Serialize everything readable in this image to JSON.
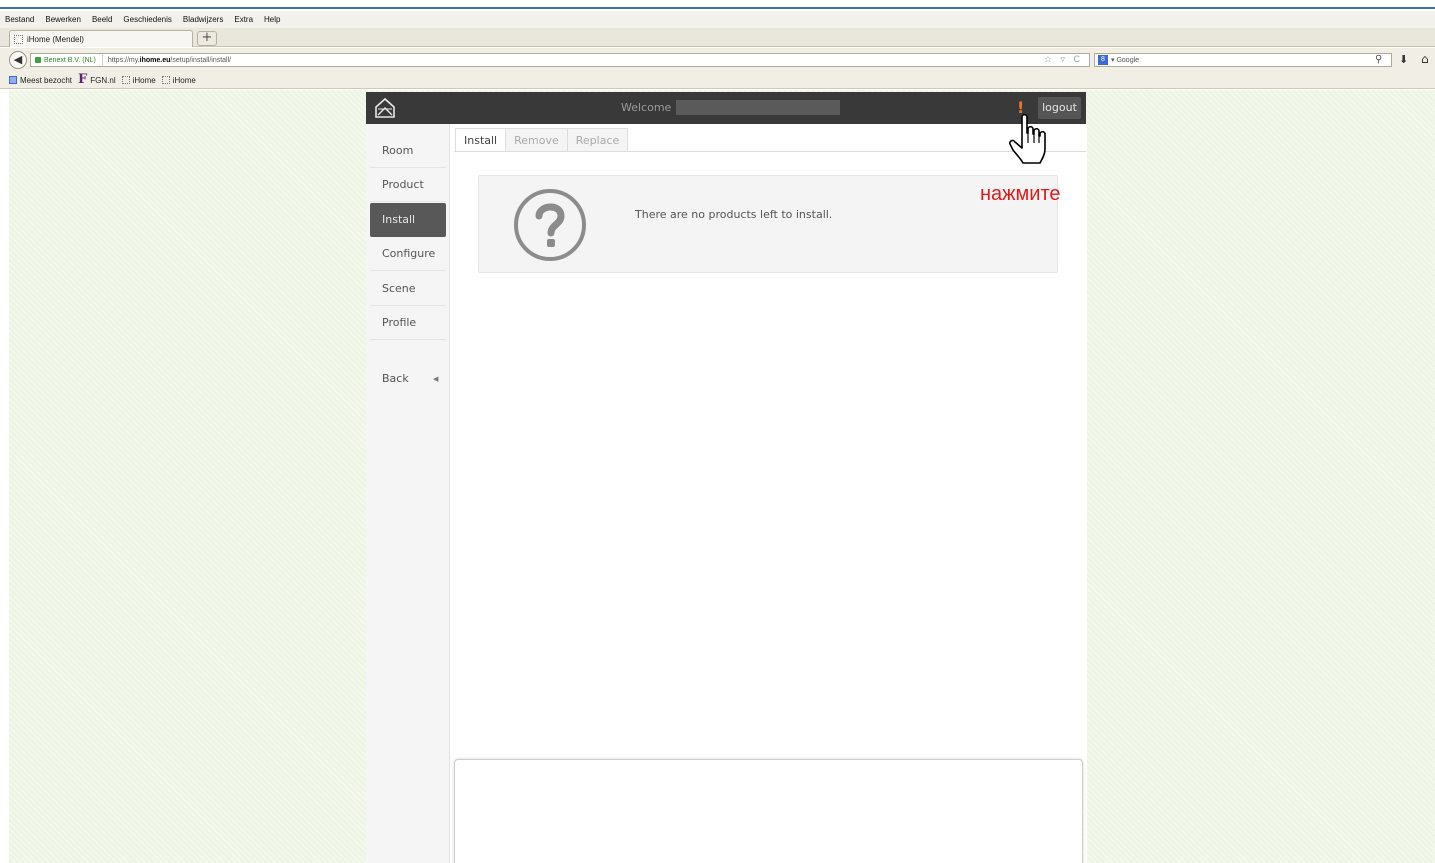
{
  "browser": {
    "menu": [
      "Bestand",
      "Bewerken",
      "Beeld",
      "Geschiedenis",
      "Bladwijzers",
      "Extra",
      "Help"
    ],
    "tab_title": "iHome (Mendel)",
    "new_tab": "+",
    "back_icon": "back-arrow-icon",
    "identity": "Benext B.V. (NL)",
    "url_prefix": "https://my.",
    "url_host": "ihome.eu",
    "url_path": "/setup/install/install/",
    "url_icons": "☆ ▿ C",
    "search_engine_label": "8",
    "search_placeholder": "Google",
    "bookmarks": [
      {
        "label": "Meest bezocht"
      },
      {
        "label": "FGN.nl"
      },
      {
        "label": "iHome"
      },
      {
        "label": "iHome"
      }
    ]
  },
  "app": {
    "welcome": "Welcome",
    "alert": "!",
    "logout": "logout",
    "sidebar": [
      "Room",
      "Product",
      "Install",
      "Configure",
      "Scene",
      "Profile"
    ],
    "sidebar_active": "Install",
    "back": "Back",
    "tabs": [
      "Install",
      "Remove",
      "Replace"
    ],
    "active_tab": "Install",
    "message": "There are no products left to install.",
    "accent_color": "#e8782f"
  },
  "annotation": {
    "text": "нажмите",
    "color": "#e31919"
  }
}
